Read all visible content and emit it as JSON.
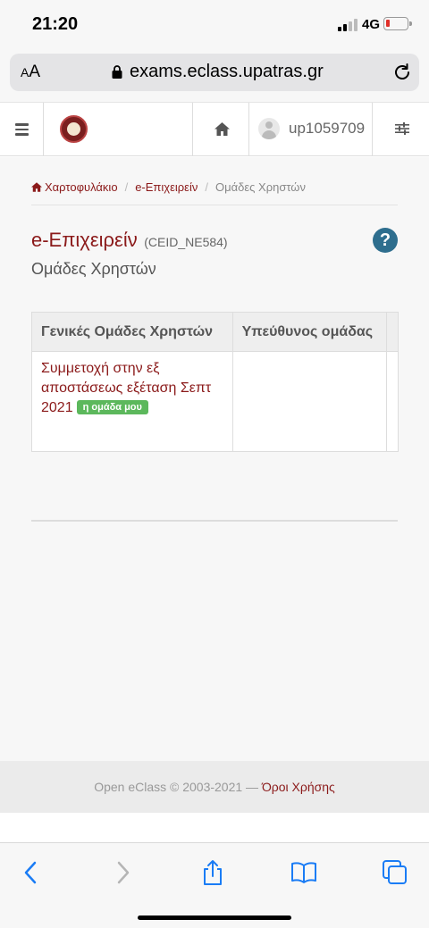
{
  "status_bar": {
    "time": "21:20",
    "network": "4G"
  },
  "browser": {
    "aa_label": "AA",
    "url": "exams.eclass.upatras.gr"
  },
  "header": {
    "username": "up1059709"
  },
  "breadcrumb": {
    "portfolio": "Χαρτοφυλάκιο",
    "course": "e-Επιχειρείν",
    "current": "Ομάδες Χρηστών"
  },
  "page": {
    "course_title": "e-Επιχειρείν",
    "course_code": "(CEID_NE584)",
    "subtitle": "Ομάδες Χρηστών",
    "help_label": "?"
  },
  "table": {
    "headers": [
      "Γενικές Ομάδες Χρηστών",
      "Υπεύθυνος ομάδας"
    ],
    "rows": [
      {
        "group_name": "Συμμετοχή στην εξ αποστάσεως εξέταση Σεπτ 2021",
        "badge": "η ομάδα μου",
        "manager": ""
      }
    ]
  },
  "footer": {
    "copyright": "Open eClass © 2003-2021 — ",
    "terms": "Όροι Χρήσης"
  },
  "colors": {
    "brand": "#8b1a1a",
    "help": "#2e6e8e",
    "badge": "#5cb85c",
    "ios_blue": "#1a7cf5"
  }
}
